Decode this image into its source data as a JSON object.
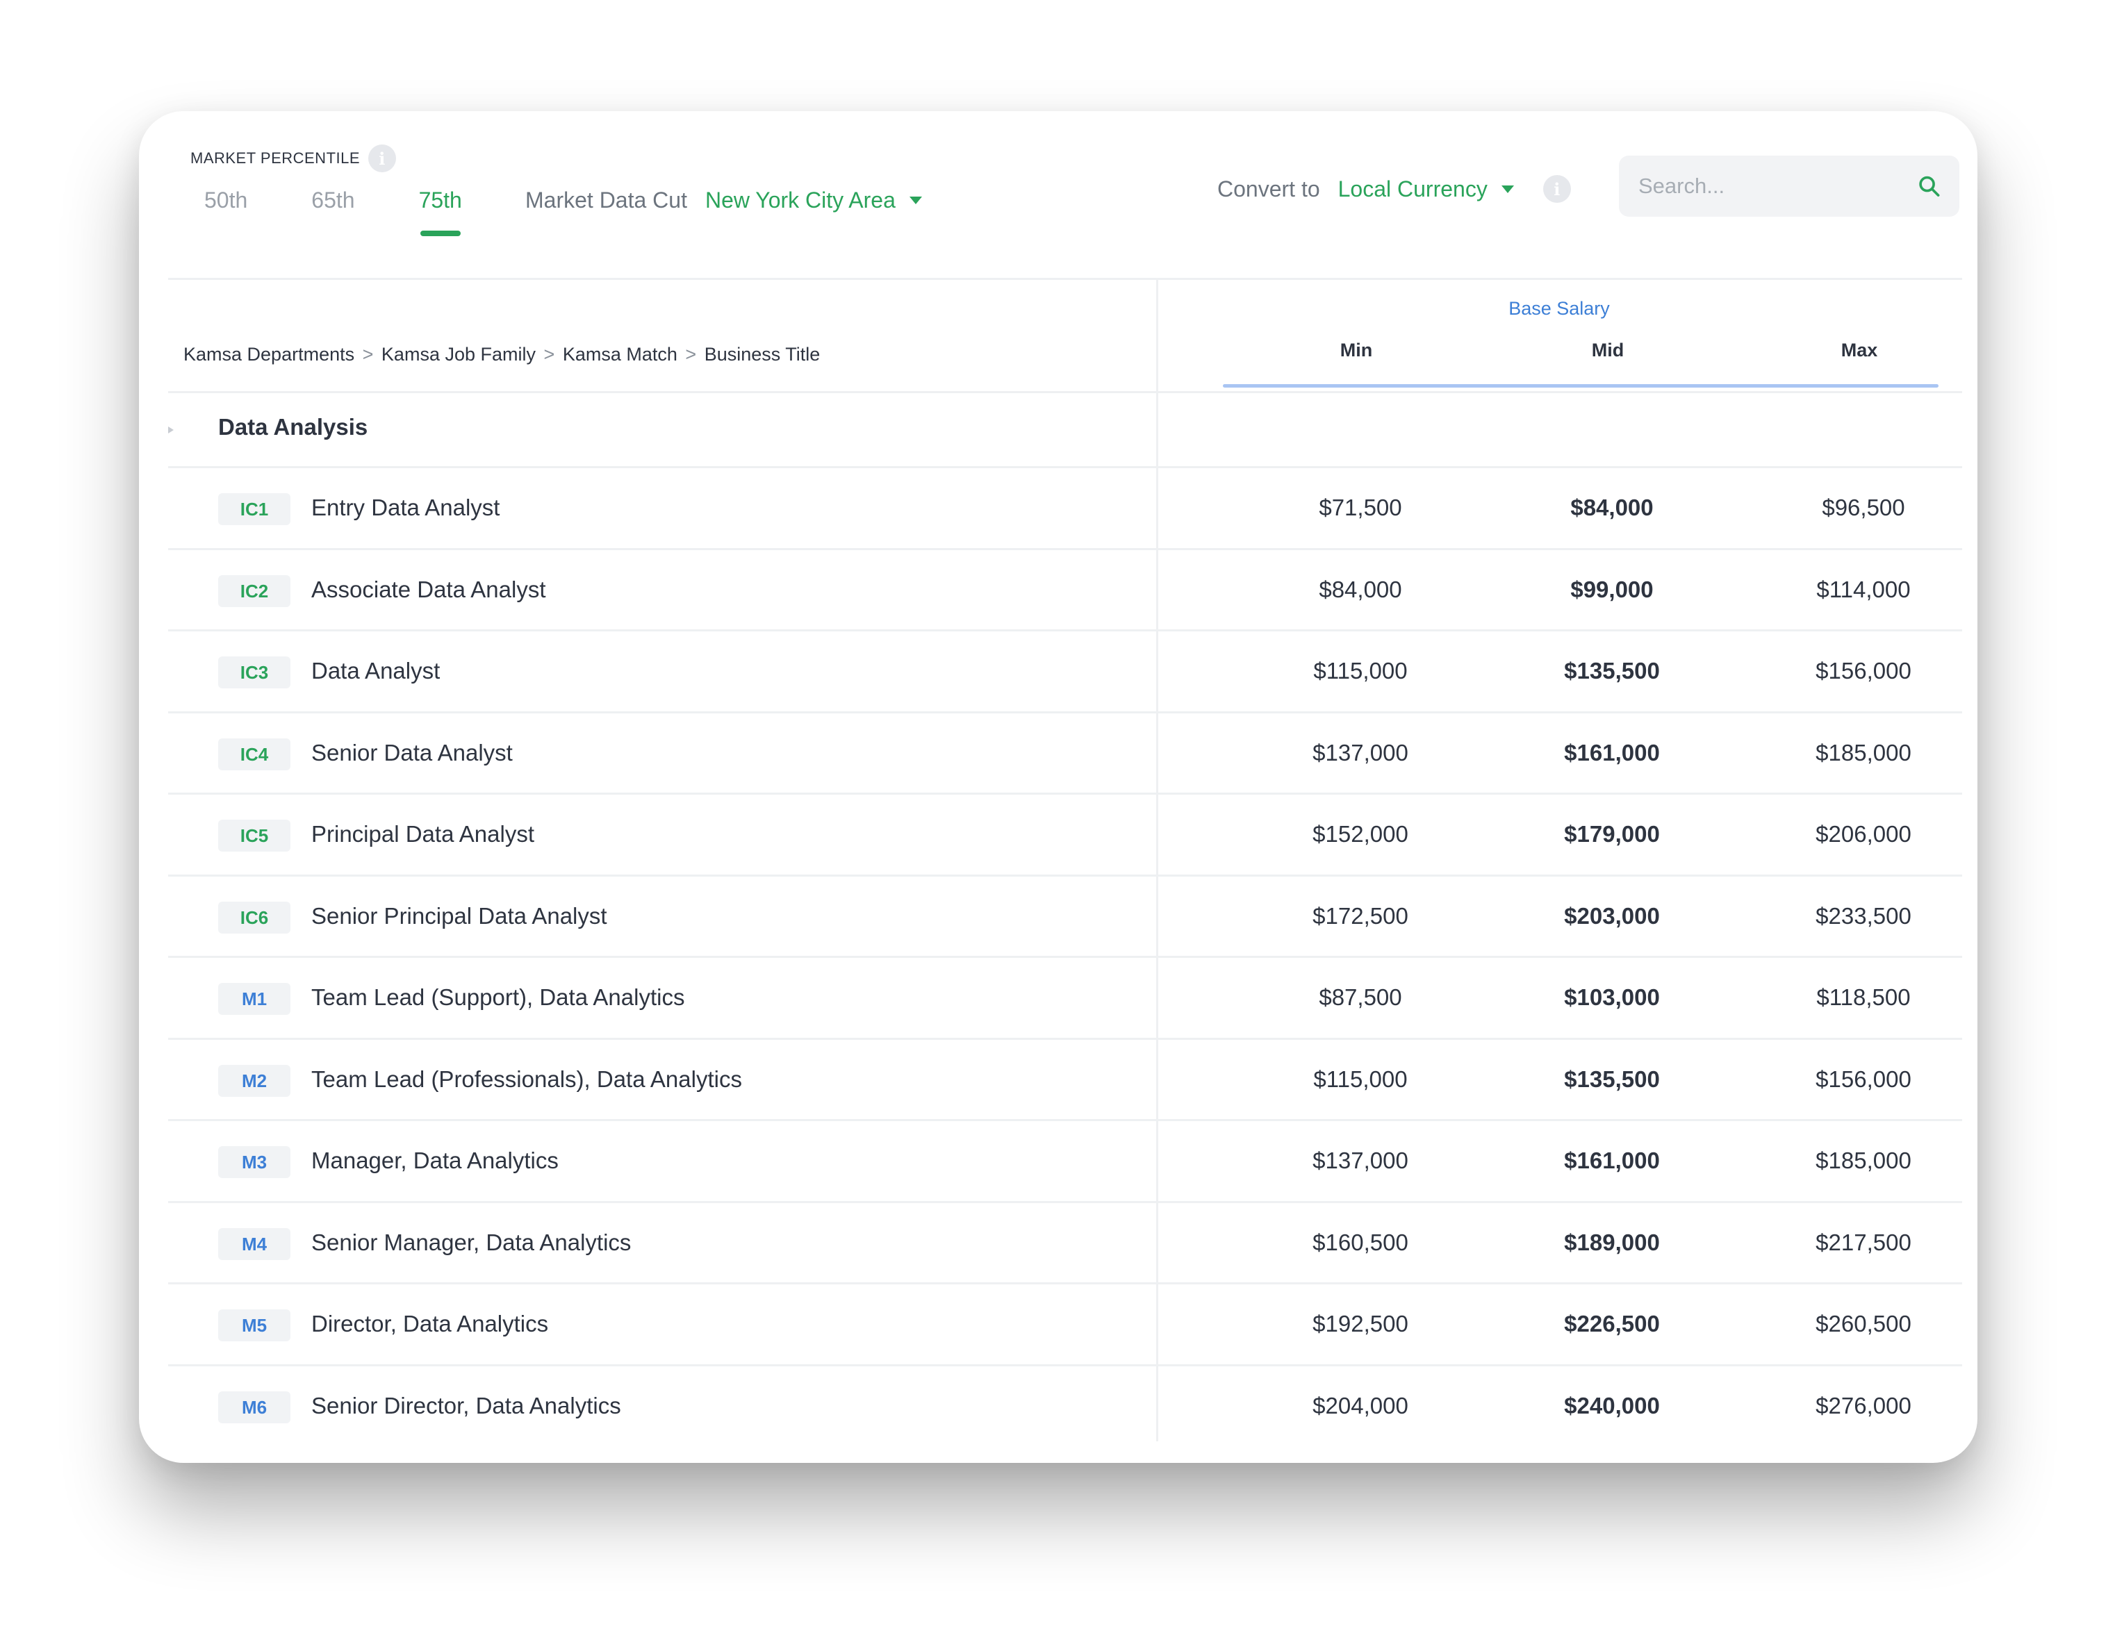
{
  "toolbar": {
    "market_percentile_label": "MARKET PERCENTILE",
    "info_icon_glyph": "i",
    "percentile_tabs": [
      "50th",
      "65th",
      "75th"
    ],
    "active_tab": "75th",
    "market_data_cut_label": "Market Data Cut",
    "market_data_cut_value": "New York City Area",
    "convert_label": "Convert to",
    "convert_value": "Local Currency",
    "search_placeholder": "Search..."
  },
  "table": {
    "breadcrumb": [
      "Kamsa Departments",
      "Kamsa Job Family",
      "Kamsa Match",
      "Business Title"
    ],
    "breadcrumb_separator": ">",
    "group_header": "Base Salary",
    "columns": [
      "Min",
      "Mid",
      "Max"
    ],
    "group_name": "Data Analysis",
    "rows": [
      {
        "level": "IC1",
        "title": "Entry Data Analyst",
        "min": "$71,500",
        "mid": "$84,000",
        "max": "$96,500"
      },
      {
        "level": "IC2",
        "title": "Associate Data Analyst",
        "min": "$84,000",
        "mid": "$99,000",
        "max": "$114,000"
      },
      {
        "level": "IC3",
        "title": "Data Analyst",
        "min": "$115,000",
        "mid": "$135,500",
        "max": "$156,000"
      },
      {
        "level": "IC4",
        "title": "Senior Data Analyst",
        "min": "$137,000",
        "mid": "$161,000",
        "max": "$185,000"
      },
      {
        "level": "IC5",
        "title": "Principal Data Analyst",
        "min": "$152,000",
        "mid": "$179,000",
        "max": "$206,000"
      },
      {
        "level": "IC6",
        "title": "Senior Principal Data Analyst",
        "min": "$172,500",
        "mid": "$203,000",
        "max": "$233,500"
      },
      {
        "level": "M1",
        "title": "Team Lead (Support), Data Analytics",
        "min": "$87,500",
        "mid": "$103,000",
        "max": "$118,500"
      },
      {
        "level": "M2",
        "title": "Team Lead (Professionals), Data Analytics",
        "min": "$115,000",
        "mid": "$135,500",
        "max": "$156,000"
      },
      {
        "level": "M3",
        "title": "Manager, Data Analytics",
        "min": "$137,000",
        "mid": "$161,000",
        "max": "$185,000"
      },
      {
        "level": "M4",
        "title": "Senior Manager, Data Analytics",
        "min": "$160,500",
        "mid": "$189,000",
        "max": "$217,500"
      },
      {
        "level": "M5",
        "title": "Director, Data Analytics",
        "min": "$192,500",
        "mid": "$226,500",
        "max": "$260,500"
      },
      {
        "level": "M6",
        "title": "Senior Director, Data Analytics",
        "min": "$204,000",
        "mid": "$240,000",
        "max": "$276,000"
      }
    ]
  },
  "colors": {
    "accent_green": "#2aa35a",
    "accent_blue": "#3d7fd6",
    "text_dark": "#2e3440",
    "text_muted": "#9aa0a8"
  },
  "icons": {
    "info": "info-icon",
    "search": "search-icon",
    "dropdown": "caret-down-icon",
    "group_toggle": "chevron-right-icon"
  }
}
